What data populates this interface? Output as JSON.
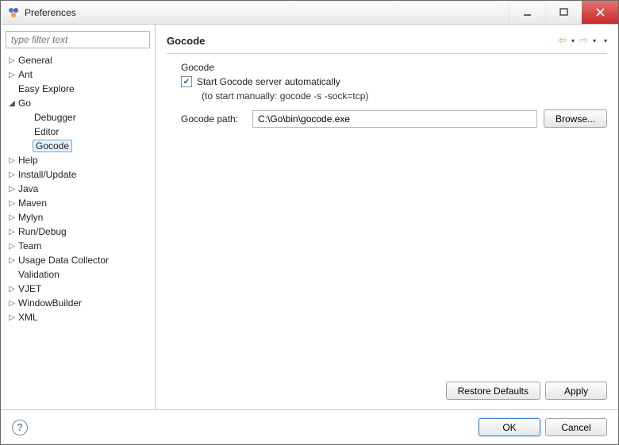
{
  "window": {
    "title": "Preferences"
  },
  "sidebar": {
    "filter_placeholder": "type filter text",
    "items": [
      {
        "label": "General",
        "expandable": true,
        "expanded": false
      },
      {
        "label": "Ant",
        "expandable": true,
        "expanded": false
      },
      {
        "label": "Easy Explore",
        "expandable": false
      },
      {
        "label": "Go",
        "expandable": true,
        "expanded": true,
        "children": [
          {
            "label": "Debugger"
          },
          {
            "label": "Editor"
          },
          {
            "label": "Gocode",
            "selected": true
          }
        ]
      },
      {
        "label": "Help",
        "expandable": true,
        "expanded": false
      },
      {
        "label": "Install/Update",
        "expandable": true,
        "expanded": false
      },
      {
        "label": "Java",
        "expandable": true,
        "expanded": false
      },
      {
        "label": "Maven",
        "expandable": true,
        "expanded": false
      },
      {
        "label": "Mylyn",
        "expandable": true,
        "expanded": false
      },
      {
        "label": "Run/Debug",
        "expandable": true,
        "expanded": false
      },
      {
        "label": "Team",
        "expandable": true,
        "expanded": false
      },
      {
        "label": "Usage Data Collector",
        "expandable": true,
        "expanded": false
      },
      {
        "label": "Validation",
        "expandable": false
      },
      {
        "label": "VJET",
        "expandable": true,
        "expanded": false
      },
      {
        "label": "WindowBuilder",
        "expandable": true,
        "expanded": false
      },
      {
        "label": "XML",
        "expandable": true,
        "expanded": false
      }
    ]
  },
  "panel": {
    "title": "Gocode",
    "group_label": "Gocode",
    "start_checkbox_label": "Start Gocode server automatically",
    "start_checkbox_checked": true,
    "hint": "(to start manually: gocode -s -sock=tcp)",
    "path_label": "Gocode path:",
    "path_value": "C:\\Go\\bin\\gocode.exe",
    "browse_label": "Browse...",
    "restore_label": "Restore Defaults",
    "apply_label": "Apply"
  },
  "bottom": {
    "ok_label": "OK",
    "cancel_label": "Cancel"
  },
  "colors": {
    "back_arrow": "#e8a33b",
    "fwd_arrow": "#bdbdbd"
  }
}
